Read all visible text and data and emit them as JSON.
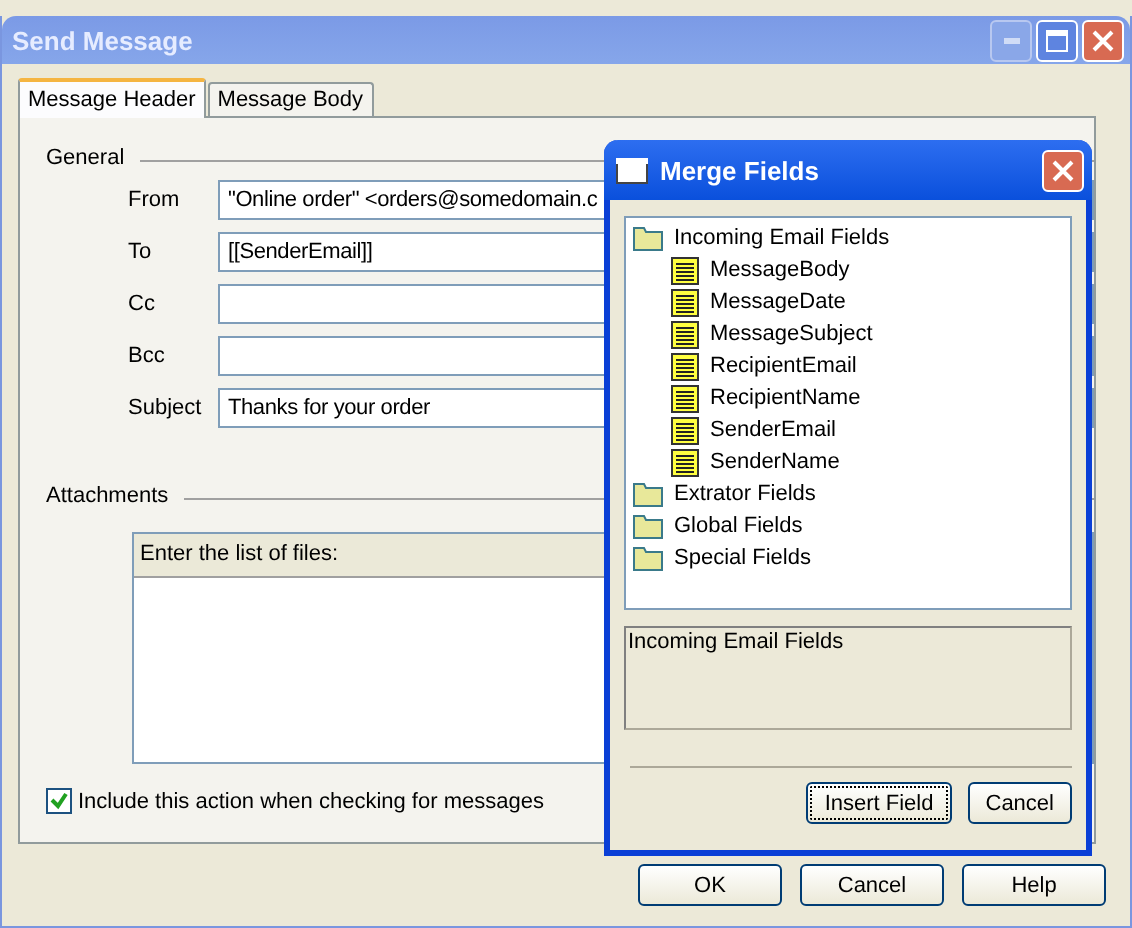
{
  "window": {
    "title": "Send Message"
  },
  "tabs": [
    {
      "label": "Message Header",
      "selected": true
    },
    {
      "label": "Message Body",
      "selected": false
    }
  ],
  "general": {
    "heading": "General",
    "fields": [
      {
        "label": "From",
        "value": "\"Online order\" <orders@somedomain.c"
      },
      {
        "label": "To",
        "value": "[[SenderEmail]]"
      },
      {
        "label": "Cc"
      },
      {
        "label": "Bcc"
      },
      {
        "label": "Subject",
        "value": "Thanks for your order"
      }
    ]
  },
  "attachments": {
    "heading": "Attachments",
    "list_header": "Enter the list of files:"
  },
  "include_option": {
    "label": "Include this action when checking for messages",
    "checked": true
  },
  "buttons": [
    "OK",
    "Cancel",
    "Help"
  ],
  "merge_dialog": {
    "title": "Merge Fields",
    "tree": [
      {
        "label": "Incoming Email Fields",
        "children": [
          {
            "label": "MessageBody"
          },
          {
            "label": "MessageDate"
          },
          {
            "label": "MessageSubject"
          },
          {
            "label": "RecipientEmail"
          },
          {
            "label": "RecipientName"
          },
          {
            "label": "SenderEmail"
          },
          {
            "label": "SenderName"
          }
        ]
      },
      {
        "label": "Extrator Fields"
      },
      {
        "label": "Global Fields"
      },
      {
        "label": "Special Fields"
      }
    ],
    "description": "Incoming Email Fields",
    "buttons": [
      {
        "label": "Insert Field",
        "focused": true
      },
      {
        "label": "Cancel",
        "focused": false
      }
    ]
  }
}
